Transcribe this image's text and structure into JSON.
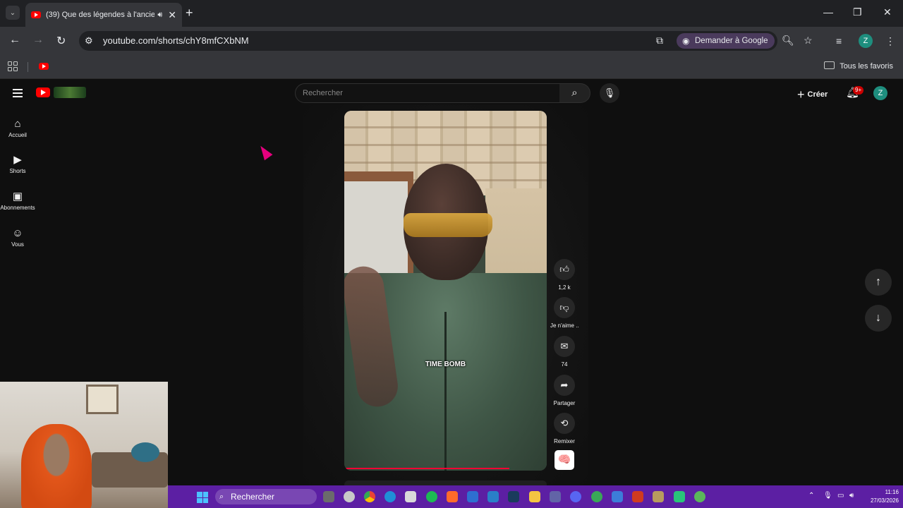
{
  "browser": {
    "tab": {
      "title": "(39) Que des légendes à l'ancie"
    },
    "address": {
      "url": "youtube.com/shorts/chY8mfCXbNM"
    },
    "google_lens": {
      "label": "Demander à Google"
    },
    "profile_letter": "Z",
    "bookmarks": {
      "all_label": "Tous les favoris"
    }
  },
  "youtube": {
    "search": {
      "placeholder": "Rechercher"
    },
    "create_label": "Créer",
    "notif_badge": "9+",
    "avatar_letter": "Z",
    "guide": [
      {
        "label": "Accueil"
      },
      {
        "label": "Shorts"
      },
      {
        "label": "Abonnements"
      },
      {
        "label": "Vous"
      }
    ],
    "short": {
      "caption": "TIME BOMB",
      "progress": 0.82,
      "likes": "1,2 k",
      "dislike_label": "Je n'aime ..",
      "comments": "74",
      "share_label": "Partager",
      "remix_label": "Remixer"
    }
  },
  "taskbar": {
    "search_label": "Rechercher",
    "time": "11:16",
    "date": "27/03/2026"
  }
}
